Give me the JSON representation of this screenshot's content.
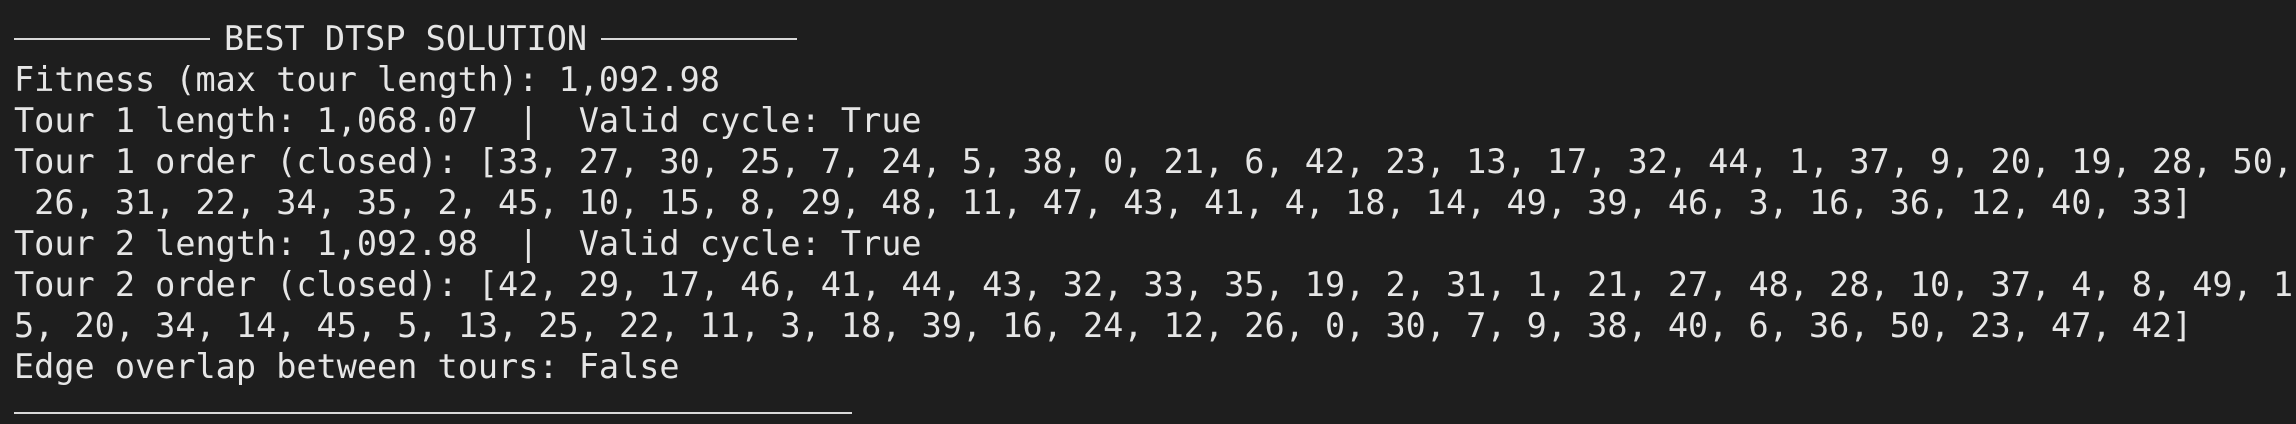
{
  "header": {
    "title": "BEST DTSP SOLUTION"
  },
  "lines": {
    "fitness": "Fitness (max tour length): 1,092.98",
    "tour1_length": "Tour 1 length: 1,068.07  |  Valid cycle: True",
    "tour1_order_a": "Tour 1 order (closed): [33, 27, 30, 25, 7, 24, 5, 38, 0, 21, 6, 42, 23, 13, 17, 32, 44, 1, 37, 9, 20, 19, 28, 50,",
    "tour1_order_b": " 26, 31, 22, 34, 35, 2, 45, 10, 15, 8, 29, 48, 11, 47, 43, 41, 4, 18, 14, 49, 39, 46, 3, 16, 36, 12, 40, 33]",
    "tour2_length": "Tour 2 length: 1,092.98  |  Valid cycle: True",
    "tour2_order_a": "Tour 2 order (closed): [42, 29, 17, 46, 41, 44, 43, 32, 33, 35, 19, 2, 31, 1, 21, 27, 48, 28, 10, 37, 4, 8, 49, 1",
    "tour2_order_b": "5, 20, 34, 14, 45, 5, 13, 25, 22, 11, 3, 18, 39, 16, 24, 12, 26, 0, 30, 7, 9, 38, 40, 6, 36, 50, 23, 47, 42]",
    "edge_overlap": "Edge overlap between tours: False"
  }
}
